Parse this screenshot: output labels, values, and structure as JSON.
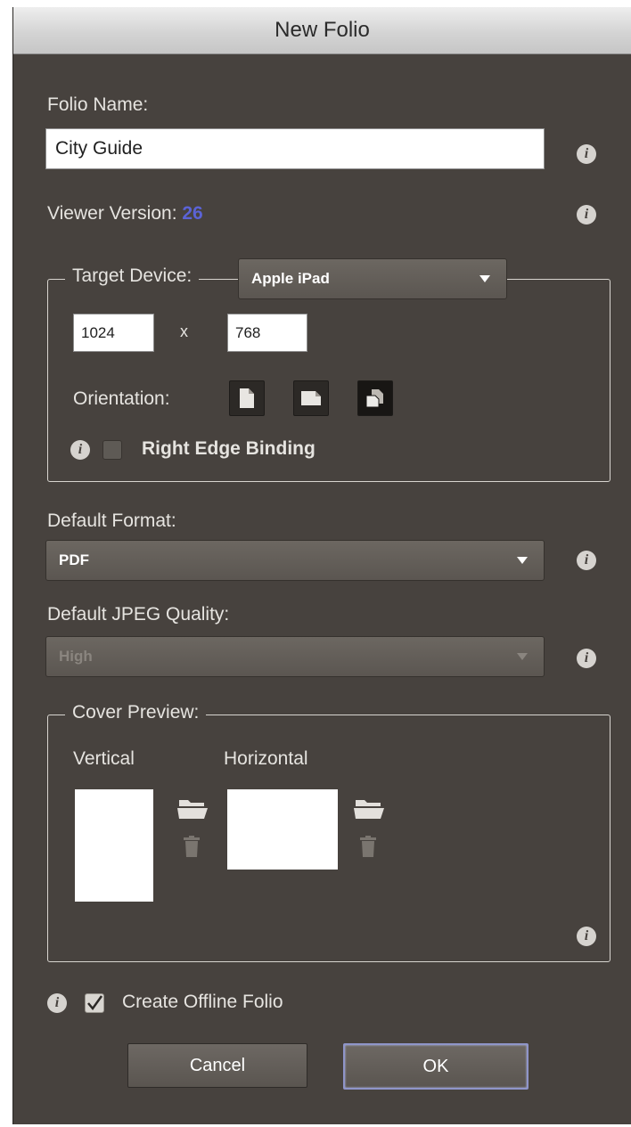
{
  "window": {
    "title": "New Folio"
  },
  "folio_name": {
    "label": "Folio Name:",
    "value": "City Guide"
  },
  "viewer_version": {
    "label": "Viewer Version:",
    "value": "26"
  },
  "target_device": {
    "label": "Target Device:",
    "selected": "Apple iPad",
    "width": "1024",
    "separator": "x",
    "height": "768",
    "orientation_label": "Orientation:",
    "orientations": [
      "portrait",
      "landscape",
      "both"
    ],
    "selected_orientation": "both",
    "right_edge_binding_label": "Right Edge Binding",
    "right_edge_binding_checked": false
  },
  "default_format": {
    "label": "Default Format:",
    "selected": "PDF"
  },
  "jpeg_quality": {
    "label": "Default JPEG Quality:",
    "selected": "High",
    "enabled": false
  },
  "cover_preview": {
    "label": "Cover Preview:",
    "vertical_label": "Vertical",
    "horizontal_label": "Horizontal"
  },
  "offline_folio": {
    "label": "Create Offline Folio",
    "checked": true
  },
  "buttons": {
    "cancel": "Cancel",
    "ok": "OK"
  },
  "colors": {
    "dialog_bg": "#47423e",
    "accent_value": "#5b63d6",
    "default_button_ring": "#8f95c9"
  },
  "icons": [
    "info-icon",
    "folder-icon",
    "trash-icon",
    "dropdown-arrow-icon",
    "checkmark-icon"
  ]
}
